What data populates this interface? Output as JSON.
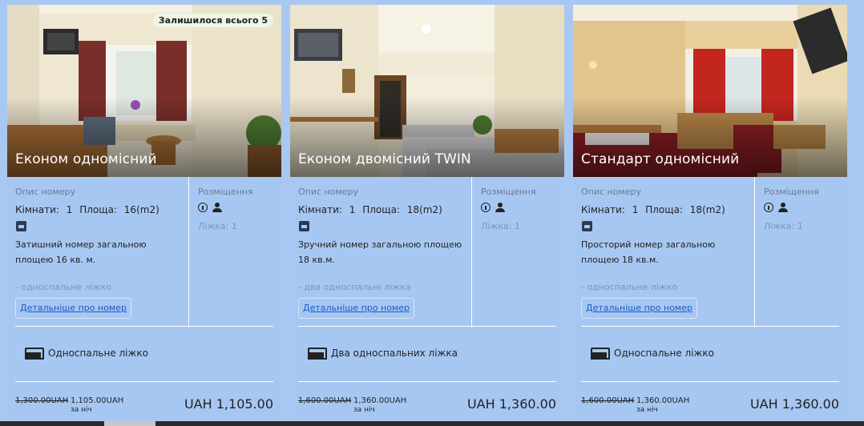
{
  "cards": [
    {
      "title": "Економ одномісний",
      "badge": "Залишилося всього 5",
      "desc_label": "Опис номеру",
      "rooms_label": "Кімнати:",
      "rooms_value": "1",
      "area_label": "Площа:",
      "area_value": "16(m2)",
      "description": "Затишний номер загальною площею 16 кв. м.",
      "beds_note": "- односпальне ліжко",
      "more_link": "Детальніше про номер",
      "place_label": "Розміщення",
      "beds_count": "Ліжка: 1",
      "bed_type": "Односпальне ліжко",
      "old_price": "1,300.00UAH",
      "new_price": "1,105.00UAH",
      "per_night": "за ніч",
      "total": "UAH 1,105.00"
    },
    {
      "title": "Економ двомісний TWIN",
      "badge": "",
      "desc_label": "Опис номеру",
      "rooms_label": "Кімнати:",
      "rooms_value": "1",
      "area_label": "Площа:",
      "area_value": "18(m2)",
      "description": "Зручний номер загальною площею 18 кв.м.",
      "beds_note": "- два односпальні ліжка",
      "more_link": "Детальніше про номер",
      "place_label": "Розміщення",
      "beds_count": "Ліжка: 1",
      "bed_type": "Два односпальних ліжка",
      "old_price": "1,600.00UAH",
      "new_price": "1,360.00UAH",
      "per_night": "за ніч",
      "total": "UAH 1,360.00"
    },
    {
      "title": "Стандарт одномісний",
      "badge": "",
      "desc_label": "Опис номеру",
      "rooms_label": "Кімнати:",
      "rooms_value": "1",
      "area_label": "Площа:",
      "area_value": "18(m2)",
      "description": "Просторий номер загальною площею 18 кв.м.",
      "beds_note": "- односпальне ліжко",
      "more_link": "Детальніше про номер",
      "place_label": "Розміщення",
      "beds_count": "Ліжка: 1",
      "bed_type": "Односпальне ліжко",
      "old_price": "1,600.00UAH",
      "new_price": "1,360.00UAH",
      "per_night": "за ніч",
      "total": "UAH 1,360.00"
    }
  ],
  "icons": {
    "info": "info-icon",
    "person": "person-icon",
    "bed": "bed-icon",
    "size": "room-size-icon"
  },
  "colors": {
    "page_bg": "#a9c8f1",
    "card_bg": "#a7c7f3",
    "link": "#1a5bc4",
    "muted": "#7f93b0"
  }
}
